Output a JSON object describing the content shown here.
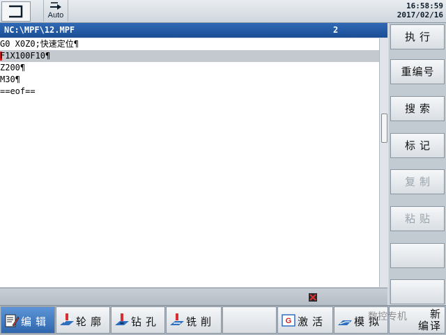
{
  "header": {
    "mode_icon": "mode-bracket-icon",
    "auto_icon": "arrow-right-bar-icon",
    "auto_label": "Auto",
    "time": "16:58:59",
    "date": "2017/02/16"
  },
  "program": {
    "path": "NC:\\MPF\\12.MPF",
    "number": "2"
  },
  "code_lines": [
    "G0 X0Z0;快速定位¶",
    "F1X100F10¶",
    "Z200¶",
    "M30¶",
    "==eof=="
  ],
  "softkeys_right": [
    {
      "label": "执行",
      "enabled": true
    },
    {
      "label": "重编号",
      "enabled": true
    },
    {
      "label": "搜索",
      "enabled": true
    },
    {
      "label": "标记",
      "enabled": true
    },
    {
      "label": "复制",
      "enabled": false
    },
    {
      "label": "粘贴",
      "enabled": false
    },
    {
      "label": "",
      "enabled": true
    },
    {
      "label": "",
      "enabled": true
    }
  ],
  "softkeys_bottom": [
    {
      "label": "编辑",
      "icon": "edit-sheet-icon",
      "active": true
    },
    {
      "label": "轮廓",
      "icon": "contour-tool-icon",
      "active": false
    },
    {
      "label": "钻孔",
      "icon": "drill-tool-icon",
      "active": false
    },
    {
      "label": "铣削",
      "icon": "mill-tool-icon",
      "active": false
    },
    {
      "label": "",
      "icon": "",
      "active": false
    },
    {
      "label": "激活",
      "icon": "g-code-icon",
      "active": false
    },
    {
      "label": "模拟",
      "icon": "simulation-icon",
      "active": false
    },
    {
      "label_line1": "新",
      "label_line2": "编译",
      "active": false
    }
  ],
  "watermark": "数控专机"
}
